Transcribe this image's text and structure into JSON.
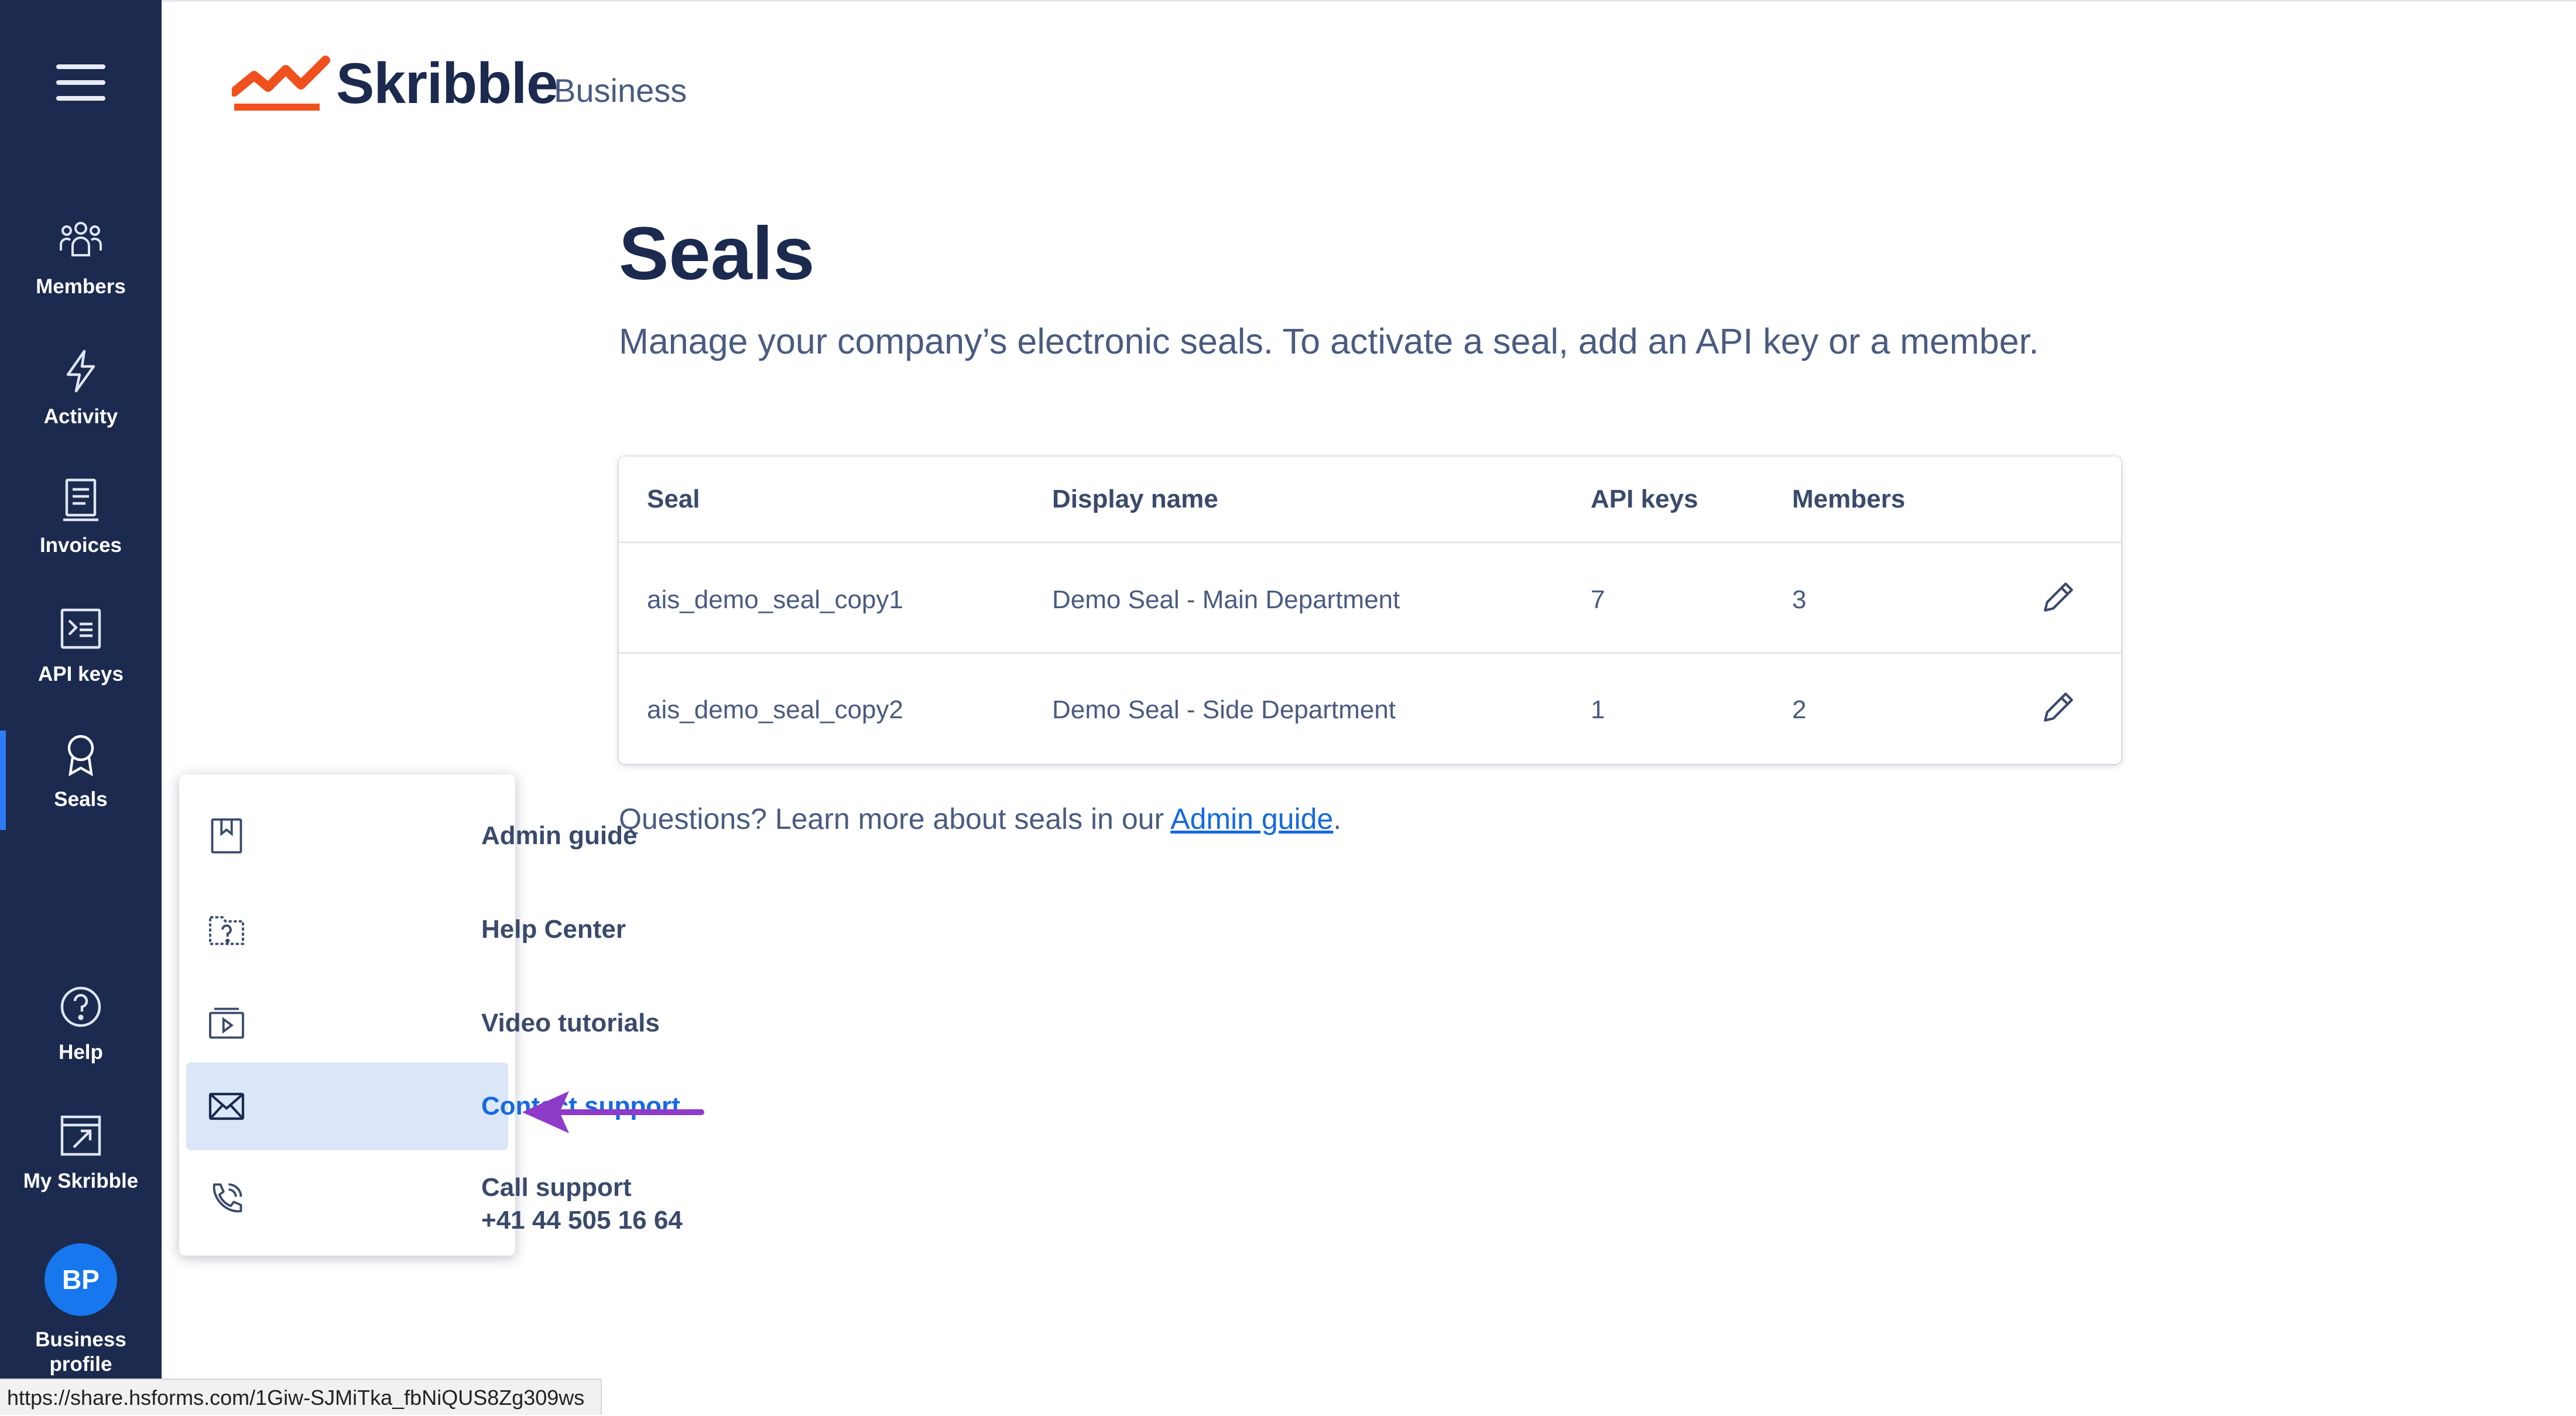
{
  "app": {
    "brand": "Skribble",
    "brand_sub": "Business",
    "colors": {
      "sidebar": "#1b2a4e",
      "accent": "#1669e0",
      "logo": "#f0501e",
      "annotation_arrow": "#8e3bc9"
    }
  },
  "sidebar": {
    "menu_icon": "hamburger-icon",
    "items": [
      {
        "label": "Members",
        "icon": "members-icon"
      },
      {
        "label": "Activity",
        "icon": "lightning-icon"
      },
      {
        "label": "Invoices",
        "icon": "invoice-icon"
      },
      {
        "label": "API keys",
        "icon": "terminal-icon"
      },
      {
        "label": "Seals",
        "icon": "seal-icon",
        "active": true
      },
      {
        "label": "Help",
        "icon": "help-icon"
      },
      {
        "label": "My Skribble",
        "icon": "external-link-icon"
      }
    ],
    "profile": {
      "initials": "BP",
      "label": "Business profile"
    }
  },
  "main": {
    "title": "Seals",
    "subtitle": "Manage your company’s electronic seals. To activate a seal, add an API key or a member.",
    "table": {
      "columns": [
        "Seal",
        "Display name",
        "API keys",
        "Members"
      ],
      "rows": [
        {
          "seal": "ais_demo_seal_copy1",
          "display_name": "Demo Seal - Main Department",
          "api_keys": "7",
          "members": "3"
        },
        {
          "seal": "ais_demo_seal_copy2",
          "display_name": "Demo Seal - Side Department",
          "api_keys": "1",
          "members": "2"
        }
      ]
    },
    "questions_prefix": "Questions? Learn more about seals in our ",
    "questions_link": "Admin guide",
    "questions_suffix": "."
  },
  "help_menu": {
    "items": [
      {
        "label": "Admin guide",
        "icon": "bookmark-book-icon"
      },
      {
        "label": "Help Center",
        "icon": "help-folder-icon"
      },
      {
        "label": "Video tutorials",
        "icon": "video-icon"
      },
      {
        "label": "Contact support",
        "icon": "mail-icon",
        "highlighted": true
      },
      {
        "label": "Call support",
        "sub": "+41 44 505 16 64",
        "icon": "phone-icon"
      }
    ]
  },
  "statusbar": {
    "url": "https://share.hsforms.com/1Giw-SJMiTka_fbNiQUS8Zg309ws"
  }
}
